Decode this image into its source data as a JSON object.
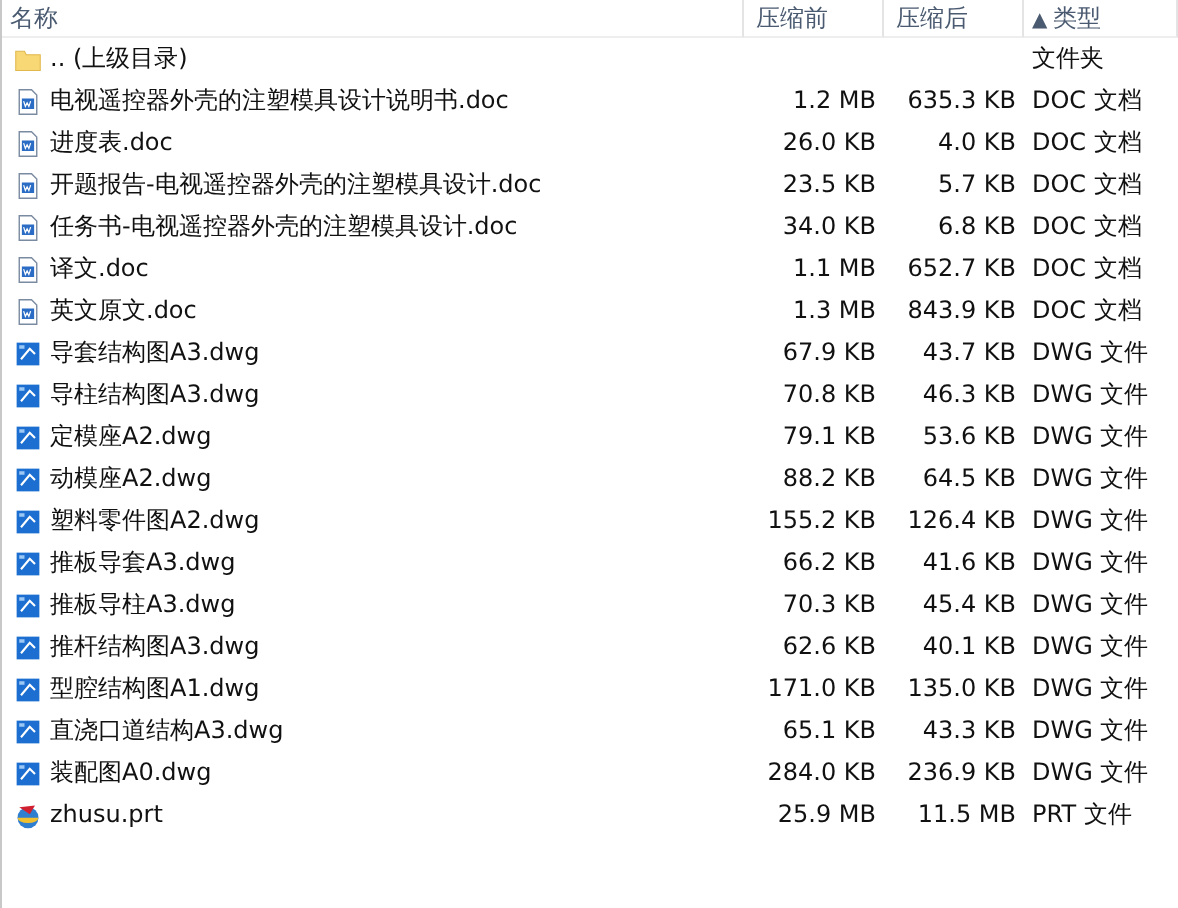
{
  "columns": [
    {
      "label": "名称"
    },
    {
      "label": "压缩前"
    },
    {
      "label": "压缩后"
    },
    {
      "label": "类型",
      "sort_arrow": "▲"
    }
  ],
  "rows": [
    {
      "kind": "folder",
      "name": ".. (上级目录)",
      "type": "文件夹"
    },
    {
      "kind": "doc",
      "name": "电视遥控器外壳的注塑模具设计说明书.doc",
      "before": "1.2 MB",
      "after": "635.3 KB",
      "type": "DOC 文档"
    },
    {
      "kind": "doc",
      "name": "进度表.doc",
      "before": "26.0 KB",
      "after": "4.0 KB",
      "type": "DOC 文档"
    },
    {
      "kind": "doc",
      "name": "开题报告-电视遥控器外壳的注塑模具设计.doc",
      "before": "23.5 KB",
      "after": "5.7 KB",
      "type": "DOC 文档"
    },
    {
      "kind": "doc",
      "name": "任务书-电视遥控器外壳的注塑模具设计.doc",
      "before": "34.0 KB",
      "after": "6.8 KB",
      "type": "DOC 文档"
    },
    {
      "kind": "doc",
      "name": "译文.doc",
      "before": "1.1 MB",
      "after": "652.7 KB",
      "type": "DOC 文档"
    },
    {
      "kind": "doc",
      "name": "英文原文.doc",
      "before": "1.3 MB",
      "after": "843.9 KB",
      "type": "DOC 文档"
    },
    {
      "kind": "dwg",
      "name": "导套结构图A3.dwg",
      "before": "67.9 KB",
      "after": "43.7 KB",
      "type": "DWG 文件"
    },
    {
      "kind": "dwg",
      "name": "导柱结构图A3.dwg",
      "before": "70.8 KB",
      "after": "46.3 KB",
      "type": "DWG 文件"
    },
    {
      "kind": "dwg",
      "name": "定模座A2.dwg",
      "before": "79.1 KB",
      "after": "53.6 KB",
      "type": "DWG 文件"
    },
    {
      "kind": "dwg",
      "name": "动模座A2.dwg",
      "before": "88.2 KB",
      "after": "64.5 KB",
      "type": "DWG 文件"
    },
    {
      "kind": "dwg",
      "name": "塑料零件图A2.dwg",
      "before": "155.2 KB",
      "after": "126.4 KB",
      "type": "DWG 文件"
    },
    {
      "kind": "dwg",
      "name": "推板导套A3.dwg",
      "before": "66.2 KB",
      "after": "41.6 KB",
      "type": "DWG 文件"
    },
    {
      "kind": "dwg",
      "name": "推板导柱A3.dwg",
      "before": "70.3 KB",
      "after": "45.4 KB",
      "type": "DWG 文件"
    },
    {
      "kind": "dwg",
      "name": "推杆结构图A3.dwg",
      "before": "62.6 KB",
      "after": "40.1 KB",
      "type": "DWG 文件"
    },
    {
      "kind": "dwg",
      "name": "型腔结构图A1.dwg",
      "before": "171.0 KB",
      "after": "135.0 KB",
      "type": "DWG 文件"
    },
    {
      "kind": "dwg",
      "name": "直浇口道结构A3.dwg",
      "before": "65.1 KB",
      "after": "43.3 KB",
      "type": "DWG 文件"
    },
    {
      "kind": "dwg",
      "name": "装配图A0.dwg",
      "before": "284.0 KB",
      "after": "236.9 KB",
      "type": "DWG 文件"
    },
    {
      "kind": "prt",
      "name": "zhusu.prt",
      "before": "25.9 MB",
      "after": "11.5 MB",
      "type": "PRT 文件"
    }
  ]
}
